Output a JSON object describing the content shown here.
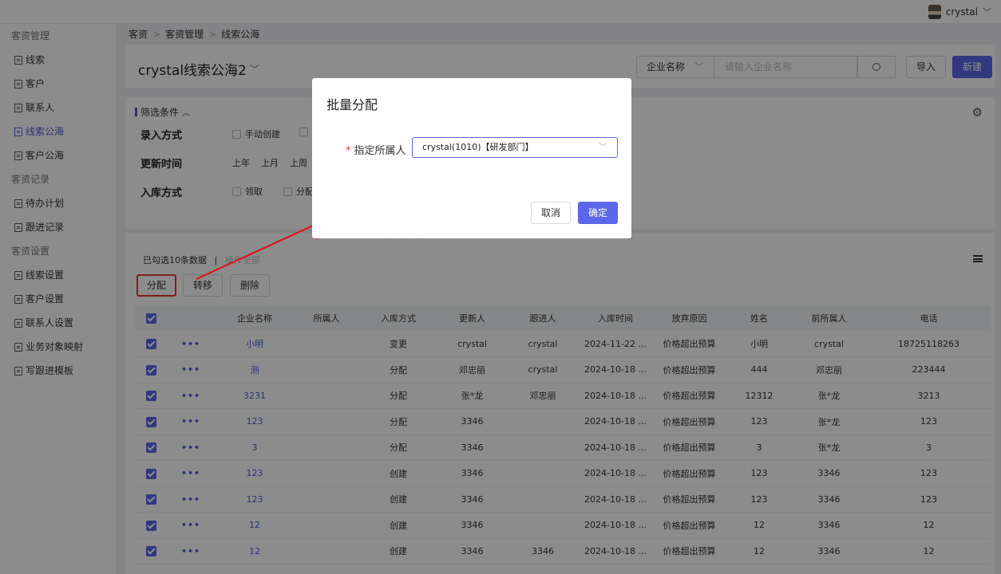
{
  "topbar": {
    "username": "crystal",
    "chevron": "﹀"
  },
  "sidebar": [
    {
      "type": "group",
      "label": "客资管理"
    },
    {
      "type": "item",
      "label": "线索"
    },
    {
      "type": "item",
      "label": "客户"
    },
    {
      "type": "item",
      "label": "联系人"
    },
    {
      "type": "item",
      "label": "线索公海",
      "active": true
    },
    {
      "type": "item",
      "label": "客户公海"
    },
    {
      "type": "group",
      "label": "客资记录"
    },
    {
      "type": "item",
      "label": "待办计划"
    },
    {
      "type": "item",
      "label": "跟进记录"
    },
    {
      "type": "group",
      "label": "客资设置"
    },
    {
      "type": "item",
      "label": "线索设置"
    },
    {
      "type": "item",
      "label": "客户设置"
    },
    {
      "type": "item",
      "label": "联系人设置"
    },
    {
      "type": "item",
      "label": "业务对象映射"
    },
    {
      "type": "item",
      "label": "写跟进模板"
    }
  ],
  "breadcrumb": [
    "客资",
    "客资管理",
    "线索公海"
  ],
  "header": {
    "title": "crystal线索公海2",
    "search_field": "企业名称",
    "search_placeholder": "请输入企业名称",
    "import_label": "导入",
    "new_label": "新建"
  },
  "filters": {
    "title": "筛选条件",
    "rows": [
      {
        "label": "录入方式",
        "options": [
          "手动创建"
        ]
      },
      {
        "label": "更新时间",
        "options": [
          "上年",
          "上月",
          "上周"
        ]
      },
      {
        "label": "入库方式",
        "options": [
          "领取",
          "分配"
        ]
      }
    ]
  },
  "table_toolbar": {
    "selected_text": "已勾选10条数据",
    "divider": "|",
    "op_all": "操作全部",
    "assign_label": "分配",
    "transfer_label": "转移",
    "delete_label": "删除"
  },
  "table": {
    "columns": [
      "",
      "",
      "企业名称",
      "所属人",
      "入库方式",
      "更新人",
      "跟进人",
      "入库时间",
      "放弃原因",
      "姓名",
      "前所属人",
      "电话"
    ],
    "rows": [
      [
        "小明",
        "",
        "变更",
        "crystal",
        "crystal",
        "2024-11-22 ...",
        "价格超出预算",
        "小明",
        "crystal",
        "18725118263"
      ],
      [
        "测",
        "",
        "分配",
        "邓忠丽",
        "crystal",
        "2024-10-18 ...",
        "价格超出预算",
        "444",
        "邓忠丽",
        "223444"
      ],
      [
        "3231",
        "",
        "分配",
        "张*龙",
        "邓忠丽",
        "2024-10-18 ...",
        "价格超出预算",
        "12312",
        "张*龙",
        "3213"
      ],
      [
        "123",
        "",
        "分配",
        "3346",
        "",
        "2024-10-18 ...",
        "价格超出预算",
        "123",
        "张*龙",
        "123"
      ],
      [
        "3",
        "",
        "分配",
        "3346",
        "",
        "2024-10-18 ...",
        "价格超出预算",
        "3",
        "张*龙",
        "3"
      ],
      [
        "123",
        "",
        "创建",
        "3346",
        "",
        "2024-10-18 ...",
        "价格超出预算",
        "123",
        "3346",
        "123"
      ],
      [
        "123",
        "",
        "创建",
        "3346",
        "",
        "2024-10-18 ...",
        "价格超出预算",
        "123",
        "3346",
        "123"
      ],
      [
        "12",
        "",
        "创建",
        "3346",
        "",
        "2024-10-18 ...",
        "价格超出预算",
        "12",
        "3346",
        "12"
      ],
      [
        "12",
        "",
        "创建",
        "3346",
        "3346",
        "2024-10-18 ...",
        "价格超出预算",
        "12",
        "3346",
        "12"
      ]
    ]
  },
  "modal": {
    "title": "批量分配",
    "field_label": "指定所属人",
    "required_mark": "*",
    "selected_value": "crystal(1010)【研发部门】",
    "cancel_label": "取消",
    "ok_label": "确定"
  },
  "annotation": {
    "text": "批量分配",
    "color": "#e10f0f"
  },
  "colors": {
    "accent": "#5a67e8",
    "highlight": "#e53935"
  }
}
